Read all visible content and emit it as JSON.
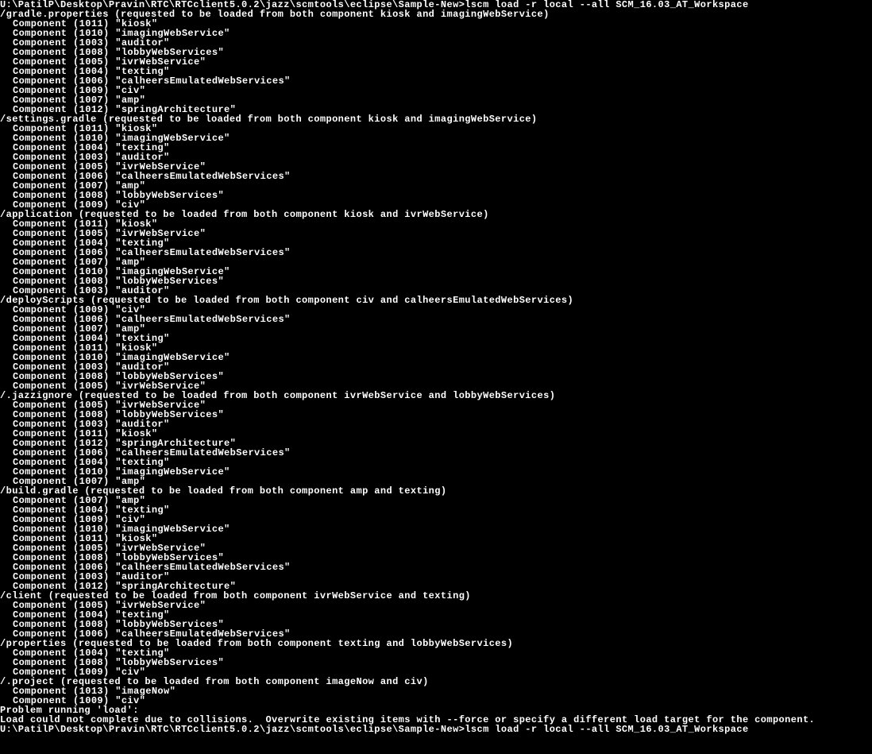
{
  "prompt_path": "U:\\PatilP\\Desktop\\Pravin\\RTC\\RTCclient5.0.2\\jazz\\scmtools\\eclipse\\Sample-New>",
  "command": "lscm load -r local --all SCM_16.03_AT_Workspace",
  "sections": [
    {
      "header": "/gradle.properties (requested to be loaded from both component kiosk and imagingWebService)",
      "components": [
        {
          "id": "1011",
          "name": "kiosk"
        },
        {
          "id": "1010",
          "name": "imagingWebService"
        },
        {
          "id": "1003",
          "name": "auditor"
        },
        {
          "id": "1008",
          "name": "lobbyWebServices"
        },
        {
          "id": "1005",
          "name": "ivrWebService"
        },
        {
          "id": "1004",
          "name": "texting"
        },
        {
          "id": "1006",
          "name": "calheersEmulatedWebServices"
        },
        {
          "id": "1009",
          "name": "civ"
        },
        {
          "id": "1007",
          "name": "amp"
        },
        {
          "id": "1012",
          "name": "springArchitecture"
        }
      ]
    },
    {
      "header": "/settings.gradle (requested to be loaded from both component kiosk and imagingWebService)",
      "components": [
        {
          "id": "1011",
          "name": "kiosk"
        },
        {
          "id": "1010",
          "name": "imagingWebService"
        },
        {
          "id": "1004",
          "name": "texting"
        },
        {
          "id": "1003",
          "name": "auditor"
        },
        {
          "id": "1005",
          "name": "ivrWebService"
        },
        {
          "id": "1006",
          "name": "calheersEmulatedWebServices"
        },
        {
          "id": "1007",
          "name": "amp"
        },
        {
          "id": "1008",
          "name": "lobbyWebServices"
        },
        {
          "id": "1009",
          "name": "civ"
        }
      ]
    },
    {
      "header": "/application (requested to be loaded from both component kiosk and ivrWebService)",
      "components": [
        {
          "id": "1011",
          "name": "kiosk"
        },
        {
          "id": "1005",
          "name": "ivrWebService"
        },
        {
          "id": "1004",
          "name": "texting"
        },
        {
          "id": "1006",
          "name": "calheersEmulatedWebServices"
        },
        {
          "id": "1007",
          "name": "amp"
        },
        {
          "id": "1010",
          "name": "imagingWebService"
        },
        {
          "id": "1008",
          "name": "lobbyWebServices"
        },
        {
          "id": "1003",
          "name": "auditor"
        }
      ]
    },
    {
      "header": "/deployScripts (requested to be loaded from both component civ and calheersEmulatedWebServices)",
      "components": [
        {
          "id": "1009",
          "name": "civ"
        },
        {
          "id": "1006",
          "name": "calheersEmulatedWebServices"
        },
        {
          "id": "1007",
          "name": "amp"
        },
        {
          "id": "1004",
          "name": "texting"
        },
        {
          "id": "1011",
          "name": "kiosk"
        },
        {
          "id": "1010",
          "name": "imagingWebService"
        },
        {
          "id": "1003",
          "name": "auditor"
        },
        {
          "id": "1008",
          "name": "lobbyWebServices"
        },
        {
          "id": "1005",
          "name": "ivrWebService"
        }
      ]
    },
    {
      "header": "/.jazzignore (requested to be loaded from both component ivrWebService and lobbyWebServices)",
      "components": [
        {
          "id": "1005",
          "name": "ivrWebService"
        },
        {
          "id": "1008",
          "name": "lobbyWebServices"
        },
        {
          "id": "1003",
          "name": "auditor"
        },
        {
          "id": "1011",
          "name": "kiosk"
        },
        {
          "id": "1012",
          "name": "springArchitecture"
        },
        {
          "id": "1006",
          "name": "calheersEmulatedWebServices"
        },
        {
          "id": "1004",
          "name": "texting"
        },
        {
          "id": "1010",
          "name": "imagingWebService"
        },
        {
          "id": "1007",
          "name": "amp"
        }
      ]
    },
    {
      "header": "/build.gradle (requested to be loaded from both component amp and texting)",
      "components": [
        {
          "id": "1007",
          "name": "amp"
        },
        {
          "id": "1004",
          "name": "texting"
        },
        {
          "id": "1009",
          "name": "civ"
        },
        {
          "id": "1010",
          "name": "imagingWebService"
        },
        {
          "id": "1011",
          "name": "kiosk"
        },
        {
          "id": "1005",
          "name": "ivrWebService"
        },
        {
          "id": "1008",
          "name": "lobbyWebServices"
        },
        {
          "id": "1006",
          "name": "calheersEmulatedWebServices"
        },
        {
          "id": "1003",
          "name": "auditor"
        },
        {
          "id": "1012",
          "name": "springArchitecture"
        }
      ]
    },
    {
      "header": "/client (requested to be loaded from both component ivrWebService and texting)",
      "components": [
        {
          "id": "1005",
          "name": "ivrWebService"
        },
        {
          "id": "1004",
          "name": "texting"
        },
        {
          "id": "1008",
          "name": "lobbyWebServices"
        },
        {
          "id": "1006",
          "name": "calheersEmulatedWebServices"
        }
      ]
    },
    {
      "header": "/properties (requested to be loaded from both component texting and lobbyWebServices)",
      "components": [
        {
          "id": "1004",
          "name": "texting"
        },
        {
          "id": "1008",
          "name": "lobbyWebServices"
        },
        {
          "id": "1009",
          "name": "civ"
        }
      ]
    },
    {
      "header": "/.project (requested to be loaded from both component imageNow and civ)",
      "components": [
        {
          "id": "1013",
          "name": "imageNow"
        },
        {
          "id": "1009",
          "name": "civ"
        }
      ]
    }
  ],
  "error_line1": "Problem running 'load':",
  "error_line2": "Load could not complete due to collisions.  Overwrite existing items with --force or specify a different load target for the component.",
  "component_prefix": "Component"
}
